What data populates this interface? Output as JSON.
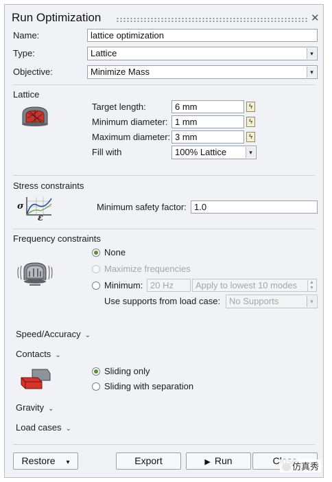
{
  "dialog": {
    "title": "Run Optimization",
    "close_glyph": "✕"
  },
  "general": {
    "name_label": "Name:",
    "name_value": "lattice optimization",
    "type_label": "Type:",
    "type_value": "Lattice",
    "objective_label": "Objective:",
    "objective_value": "Minimize Mass"
  },
  "lattice": {
    "section_label": "Lattice",
    "icon": "lattice-part-icon",
    "target_label": "Target length:",
    "target_value": "6 mm",
    "min_label": "Minimum diameter:",
    "min_value": "1 mm",
    "max_label": "Maximum diameter:",
    "max_value": "3 mm",
    "fill_label": "Fill with",
    "fill_value": "100% Lattice"
  },
  "stress": {
    "section_label": "Stress constraints",
    "icon": "stress-strain-curve-icon",
    "sigma": "σ",
    "epsilon": "ε",
    "safety_label": "Minimum safety factor:",
    "safety_value": "1.0"
  },
  "frequency": {
    "section_label": "Frequency constraints",
    "icon": "vibration-part-icon",
    "none_label": "None",
    "maximize_label": "Maximize frequencies",
    "minimum_label": "Minimum:",
    "minimum_value": "20 Hz",
    "modes_value": "Apply to lowest 10 modes",
    "supports_label": "Use supports from load case:",
    "supports_value": "No Supports",
    "selected": "None"
  },
  "sections": {
    "speed_label": "Speed/Accuracy",
    "contacts_label": "Contacts",
    "gravity_label": "Gravity",
    "loadcases_label": "Load cases",
    "chevron": "⌄"
  },
  "contacts": {
    "icon": "contact-blocks-icon",
    "sliding_only_label": "Sliding only",
    "sliding_sep_label": "Sliding with separation",
    "selected": "Sliding only"
  },
  "buttons": {
    "restore_label": "Restore",
    "export_label": "Export",
    "run_label": "Run",
    "close_label": "Close",
    "dropdown_glyph": "▾",
    "play_glyph": "▶",
    "bolt_glyph": "ϟ"
  },
  "watermark": {
    "text": "仿真秀"
  },
  "colors": {
    "panel_bg": "#f1f2f5",
    "radio_selected": "#5e8a3a",
    "disabled_text": "#a3a6ab"
  }
}
